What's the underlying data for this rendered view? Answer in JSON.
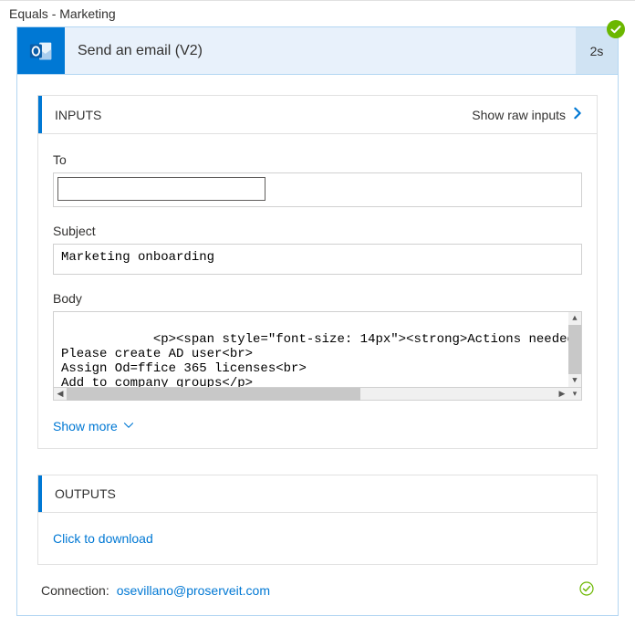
{
  "breadcrumb": "Equals - Marketing",
  "header": {
    "title": "Send an email (V2)",
    "duration": "2s"
  },
  "inputs": {
    "panel_label": "INPUTS",
    "show_raw_label": "Show raw inputs",
    "to": {
      "label": "To",
      "value": ""
    },
    "subject": {
      "label": "Subject",
      "value": "Marketing onboarding"
    },
    "body": {
      "label": "Body",
      "value": "<p><span style=\"font-size: 14px\"><strong>Actions needed Marketing<o\nPlease create AD user<br>\nAssign Od=ffice 365 licenses<br>\nAdd to company groups</p>"
    },
    "show_more_label": "Show more"
  },
  "outputs": {
    "panel_label": "OUTPUTS",
    "download_label": "Click to download"
  },
  "connection": {
    "label": "Connection:",
    "email": "osevillano@proserveit.com"
  }
}
